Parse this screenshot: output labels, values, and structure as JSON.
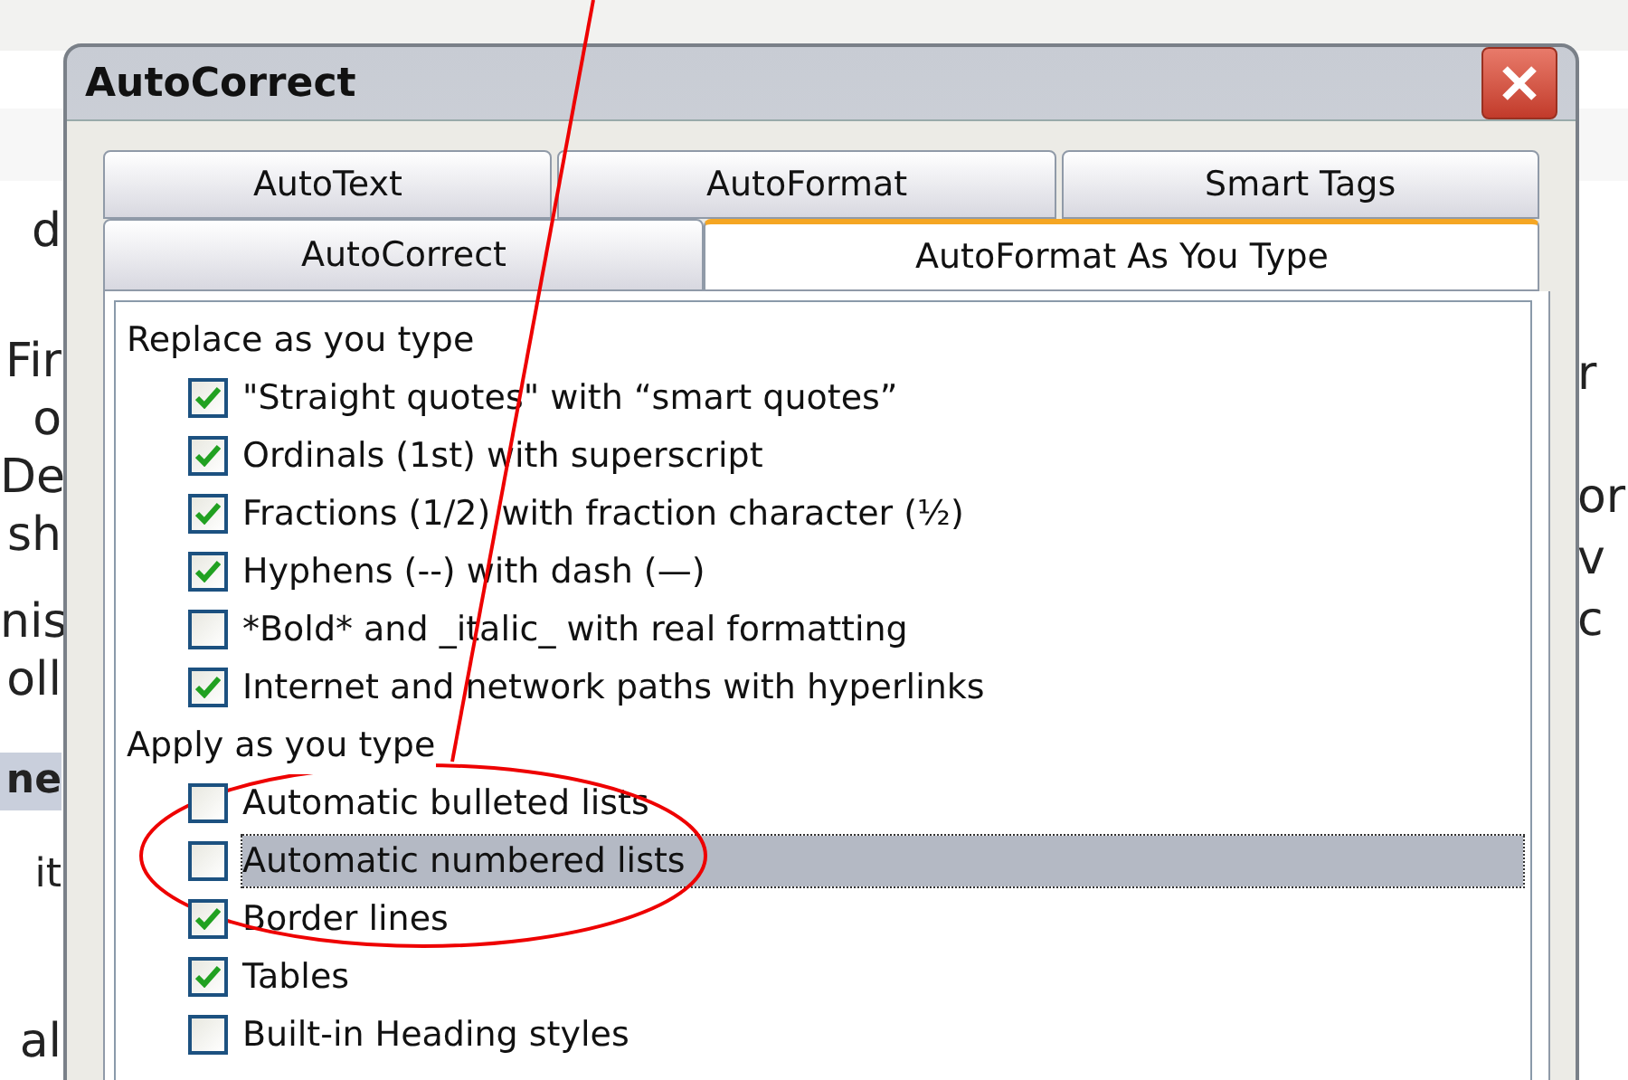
{
  "background": {
    "left_fragments": [
      "d",
      "Fir",
      "o",
      "De",
      "sh",
      "nis",
      "oll",
      "ne",
      "it",
      "al"
    ],
    "right_fragments": [
      "r",
      "or",
      "v",
      "c"
    ]
  },
  "dialog": {
    "title": "AutoCorrect",
    "tab_rows": [
      [
        {
          "label": "AutoText",
          "selected": false
        },
        {
          "label": "AutoFormat",
          "selected": false
        },
        {
          "label": "Smart Tags",
          "selected": false
        }
      ],
      [
        {
          "label": "AutoCorrect",
          "selected": false
        },
        {
          "label": "AutoFormat As You Type",
          "selected": true
        }
      ]
    ],
    "sections": [
      {
        "heading": "Replace as you type",
        "items": [
          {
            "label": "\"Straight quotes\" with “smart quotes”",
            "checked": true,
            "selected": false
          },
          {
            "label": "Ordinals (1st) with superscript",
            "checked": true,
            "selected": false
          },
          {
            "label": "Fractions (1/2) with fraction character (½)",
            "checked": true,
            "selected": false
          },
          {
            "label": "Hyphens (--) with dash (—)",
            "checked": true,
            "selected": false
          },
          {
            "label": "*Bold* and _italic_ with real formatting",
            "checked": false,
            "selected": false
          },
          {
            "label": "Internet and network paths with hyperlinks",
            "checked": true,
            "selected": false
          }
        ]
      },
      {
        "heading": "Apply as you type",
        "items": [
          {
            "label": "Automatic bulleted lists",
            "checked": false,
            "selected": false
          },
          {
            "label": "Automatic numbered lists",
            "checked": false,
            "selected": true
          },
          {
            "label": "Border lines",
            "checked": true,
            "selected": false
          },
          {
            "label": "Tables",
            "checked": true,
            "selected": false
          },
          {
            "label": "Built-in Heading styles",
            "checked": false,
            "selected": false
          }
        ]
      }
    ]
  }
}
